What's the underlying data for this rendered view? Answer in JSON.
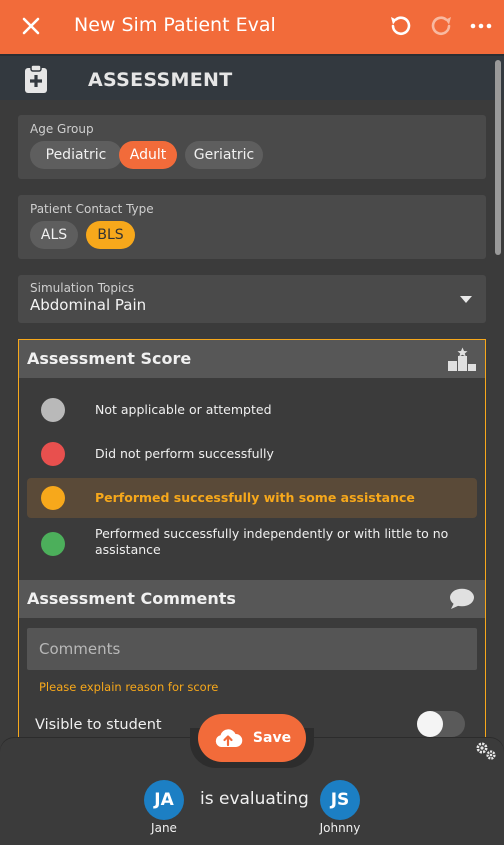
{
  "header": {
    "title": "New Sim Patient Eval"
  },
  "section": {
    "title": "ASSESSMENT"
  },
  "age_group": {
    "label": "Age Group",
    "options": [
      "Pediatric",
      "Adult",
      "Geriatric"
    ],
    "selected": "Adult"
  },
  "contact_type": {
    "label": "Patient Contact Type",
    "options": [
      "ALS",
      "BLS"
    ],
    "selected": "BLS"
  },
  "topics": {
    "label": "Simulation Topics",
    "value": "Abdominal Pain"
  },
  "score": {
    "title": "Assessment Score",
    "options": [
      {
        "text": "Not applicable or attempted",
        "color": "#b9b9b9"
      },
      {
        "text": "Did not perform successfully",
        "color": "#e8504e"
      },
      {
        "text": "Performed successfully with some assistance",
        "color": "#f7a81b"
      },
      {
        "text": "Performed successfully independently or with little to no assistance",
        "color": "#4caf5b"
      }
    ],
    "selected_index": 2
  },
  "comments": {
    "title": "Assessment Comments",
    "placeholder": "Comments",
    "hint": "Please explain reason for score",
    "visible_label": "Visible to student",
    "visible_to_student": false
  },
  "footer": {
    "save_label": "Save",
    "evaluating_text": "is evaluating",
    "evaluator": {
      "initials": "JA",
      "name": "Jane"
    },
    "student": {
      "initials": "JS",
      "name": "Johnny"
    }
  },
  "colors": {
    "accent": "#f26b3a",
    "highlight": "#f7a81b",
    "avatar": "#1c7fc4"
  }
}
